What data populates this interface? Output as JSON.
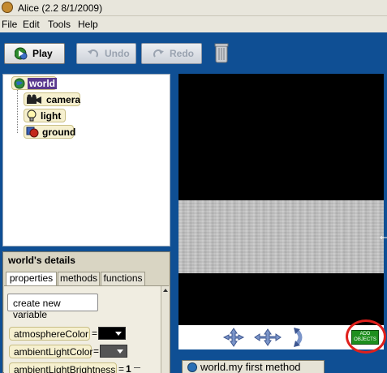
{
  "window": {
    "title": "Alice (2.2  8/1/2009)"
  },
  "menu": {
    "items": [
      "File",
      "Edit",
      "Tools",
      "Help"
    ]
  },
  "toolbar": {
    "play": "Play",
    "undo": "Undo",
    "redo": "Redo"
  },
  "tree": {
    "world": "world",
    "children": [
      "camera",
      "light",
      "ground"
    ]
  },
  "details": {
    "header": "world's details",
    "tabs": [
      "properties",
      "methods",
      "functions"
    ],
    "active_tab": "properties",
    "new_variable_button": "create new variable",
    "properties": [
      {
        "name": "atmosphereColor",
        "eq": "=",
        "color": "#000000"
      },
      {
        "name": "ambientLightColor",
        "eq": "=",
        "color": "#555555"
      },
      {
        "name": "ambientLightBrightness",
        "eq": "=",
        "value": "1"
      }
    ]
  },
  "scene_controls": {
    "add_objects_line1": "ADD",
    "add_objects_line2": "OBJECTS"
  },
  "editor": {
    "method_tab": "world.my first method"
  },
  "colors": {
    "background": "#0f4f94",
    "selected": "#5b3a8f",
    "add_objects": "#1e8f1e",
    "highlight_ring": "#e0201c"
  }
}
